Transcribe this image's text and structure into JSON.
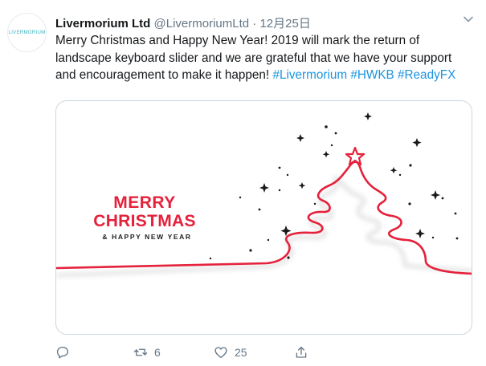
{
  "tweet": {
    "avatar_text": "LIVERMORIUM",
    "display_name": "Livermorium Ltd",
    "handle": "@LivermoriumLtd",
    "separator": "·",
    "date": "12月25日",
    "text_main": "Merry Christmas and Happy New Year! 2019 will mark the return of landscape keyboard slider and we are grateful that we have your support and encouragement to make it happen! ",
    "hashtags": [
      "#Livermorium",
      "#HWKB",
      "#ReadyFX"
    ]
  },
  "card": {
    "line1": "MERRY",
    "line2": "CHRISTMAS",
    "line3": "& HAPPY NEW YEAR",
    "accent_color": "#e5213b"
  },
  "actions": {
    "reply_icon": "reply-icon",
    "retweet_icon": "retweet-icon",
    "retweet_count": "6",
    "like_icon": "heart-icon",
    "like_count": "25",
    "share_icon": "share-icon"
  }
}
